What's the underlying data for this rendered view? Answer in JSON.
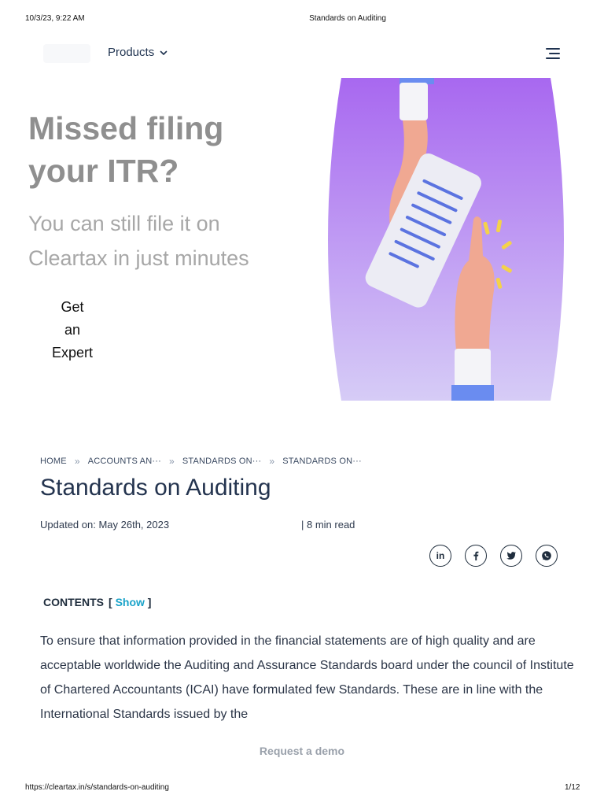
{
  "print": {
    "datetime": "10/3/23, 9:22 AM",
    "doc_title": "Standards on Auditing",
    "url": "https://cleartax.in/s/standards-on-auditing",
    "page": "1/12"
  },
  "nav": {
    "products_label": "Products",
    "menu_icon": "hamburger-menu-icon",
    "dropdown_icon": "chevron-down-icon"
  },
  "hero": {
    "title": "Missed filing your ITR?",
    "subtitle": "You can still file it on Cleartax in just minutes",
    "cta_line1": "Get",
    "cta_line2": "an",
    "cta_line3": "Expert",
    "gradient_top": "#a868f0",
    "gradient_bottom": "#d6ccf6"
  },
  "breadcrumb": {
    "items": [
      "HOME",
      "ACCOUNTS AN···",
      "STANDARDS ON···",
      "STANDARDS ON···"
    ],
    "separator": "»"
  },
  "article": {
    "title": "Standards on Auditing",
    "updated": "Updated on: May 26th, 2023",
    "read_time": "| 8 min read",
    "contents_label": "CONTENTS",
    "bracket_open": "[",
    "show_label": "Show",
    "bracket_close": "]",
    "body": "To ensure that information provided in the financial statements are of high quality and are acceptable worldwide the Auditing and Assurance Standards board under the council of Institute of Chartered Accountants (ICAI) have formulated few Standards. These are in line with the International Standards issued by the"
  },
  "share": {
    "linkedin_label": "in",
    "icons": [
      "linkedin-icon",
      "facebook-icon",
      "twitter-icon",
      "whatsapp-icon"
    ]
  },
  "footer": {
    "demo_label": "Request a demo"
  },
  "colors": {
    "accent": "#1aa3c9",
    "heading": "#24344f"
  }
}
